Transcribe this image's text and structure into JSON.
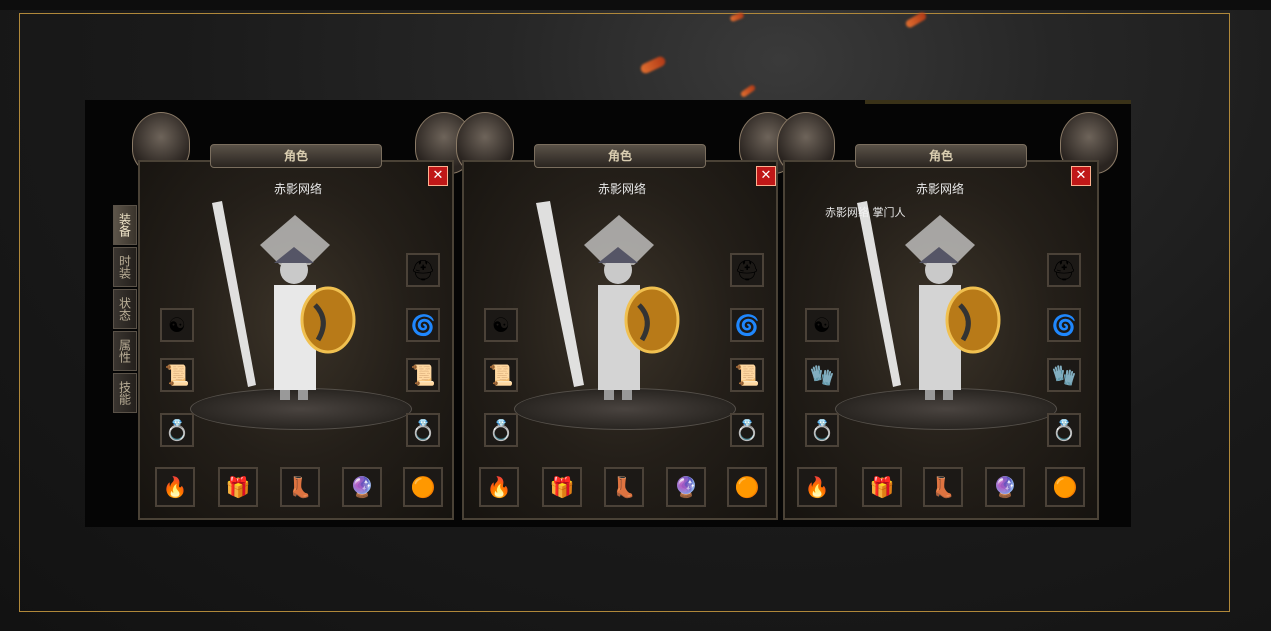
{
  "panels": [
    {
      "title": "角色",
      "close": "✕",
      "character_name": "赤影网络",
      "character_title": ""
    },
    {
      "title": "角色",
      "close": "✕",
      "character_name": "赤影网络",
      "character_title": ""
    },
    {
      "title": "角色",
      "close": "✕",
      "character_name": "赤影网络",
      "character_title": "赤影网络 掌门人"
    }
  ],
  "side_tabs": [
    "装备",
    "时装",
    "状态",
    "属性",
    "技能"
  ],
  "icons": {
    "left_slots": [
      "necklace-icon",
      "bracelet-icon",
      "ring-icon",
      "medal-icon"
    ],
    "right_slots": [
      "necklace-icon",
      "helmet-icon",
      "bracelet-icon",
      "ring-icon"
    ],
    "bottom_slots": [
      "mount-icon",
      "belt-icon",
      "boots-icon",
      "gem-purple-icon",
      "gem-gold-icon"
    ]
  },
  "colors": {
    "frame": "#b0883a",
    "close": "#c01818",
    "text": "#e8e8e8"
  }
}
